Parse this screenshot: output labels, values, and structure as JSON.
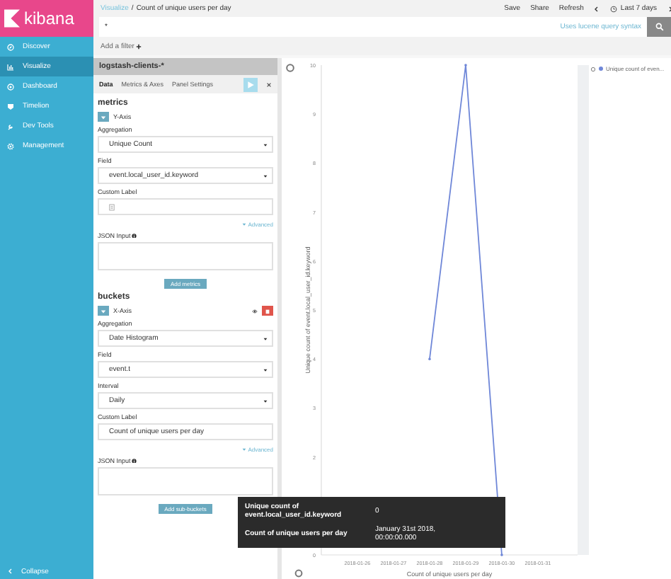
{
  "sidebar": {
    "logo": "kibana",
    "items": [
      {
        "label": "Discover",
        "selected": false
      },
      {
        "label": "Visualize",
        "selected": true
      },
      {
        "label": "Dashboard",
        "selected": false
      },
      {
        "label": "Timelion",
        "selected": false
      },
      {
        "label": "Dev Tools",
        "selected": false
      },
      {
        "label": "Management",
        "selected": false
      }
    ],
    "collapse": "Collapse"
  },
  "breadcrumb": {
    "parent": "Visualize",
    "separator": "/",
    "current": "Count of unique users per day"
  },
  "top_actions": [
    "Save",
    "Share",
    "Refresh"
  ],
  "time_picker": {
    "label": "Last 7 days"
  },
  "query": {
    "value": "*",
    "hint": "Uses lucene query syntax"
  },
  "filter_link": "Add a filter",
  "editor": {
    "index_pattern": "logstash-clients-*",
    "tabs": [
      {
        "label": "Data",
        "selected": true
      },
      {
        "label": "Metrics & Axes",
        "selected": false
      },
      {
        "label": "Panel Settings",
        "selected": false
      }
    ],
    "sections": [
      {
        "title": "metrics",
        "agg_label": "Y-Axis",
        "removable": false,
        "button": "Add metrics",
        "fields": [
          {
            "kind": "select",
            "label": "Aggregation",
            "value": "Unique Count"
          },
          {
            "kind": "select",
            "label": "Field",
            "value": "event.local_user_id.keyword"
          },
          {
            "kind": "input",
            "label": "Custom Label"
          },
          {
            "kind": "link",
            "label": "Advanced"
          },
          {
            "kind": "textarea",
            "label": "JSON Input"
          }
        ]
      },
      {
        "title": "buckets",
        "agg_label": "X-Axis",
        "removable": true,
        "button": "Add sub-buckets",
        "fields": [
          {
            "kind": "select",
            "label": "Aggregation",
            "value": "Date Histogram"
          },
          {
            "kind": "select",
            "label": "Field",
            "value": "event.t"
          },
          {
            "kind": "select",
            "label": "Interval",
            "value": "Daily"
          },
          {
            "kind": "input",
            "label": "Custom Label",
            "value": "Count of unique users per day"
          },
          {
            "kind": "link",
            "label": "Advanced"
          },
          {
            "kind": "textarea",
            "label": "JSON Input"
          }
        ]
      }
    ]
  },
  "chart": {
    "chart_data": {
      "type": "line",
      "xlabel": "Count of unique users per day",
      "ylabel": "Unique count of event.local_user_id.keyword",
      "categories": [
        "2018-01-26",
        "2018-01-27",
        "2018-01-28",
        "2018-01-29",
        "2018-01-30",
        "2018-01-31"
      ],
      "series": [
        {
          "name": "Unique count of even...",
          "color": "#6f87d8",
          "values": [
            null,
            null,
            4,
            10,
            0,
            null
          ]
        }
      ],
      "ylim": [
        0,
        10
      ],
      "yticks": [
        0,
        2,
        3,
        4,
        5,
        6,
        7,
        8,
        9,
        10
      ]
    }
  },
  "tooltip": {
    "rows": [
      {
        "label": "Unique count of event.local_user_id.keyword",
        "value": "0"
      },
      {
        "label": "Count of unique users per day",
        "value": "January 31st 2018, 00:00:00.000"
      }
    ]
  }
}
